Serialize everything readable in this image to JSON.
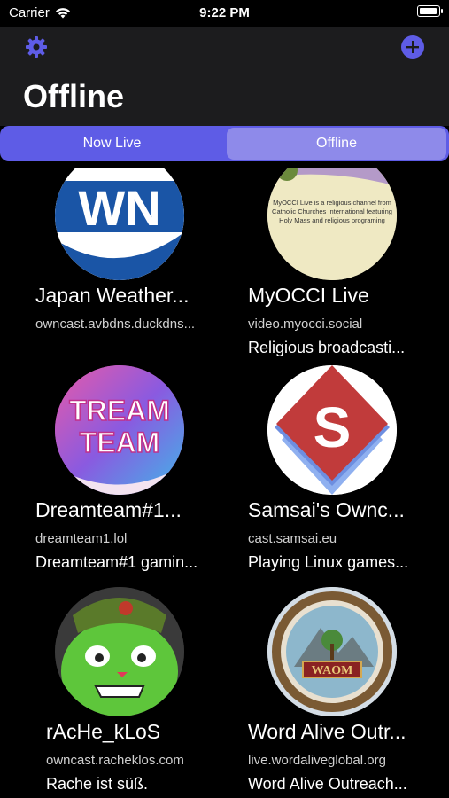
{
  "status": {
    "carrier": "Carrier",
    "time": "9:22 PM"
  },
  "header": {
    "title": "Offline"
  },
  "segments": [
    "Now Live",
    "Offline"
  ],
  "streams": [
    {
      "name": "Japan Weather...",
      "host": "owncast.avbdns.duckdns...",
      "desc": ""
    },
    {
      "name": "MyOCCI Live",
      "host": "video.myocci.social",
      "desc": "Religious broadcasti..."
    },
    {
      "name": "Dreamteam#1...",
      "host": "dreamteam1.lol",
      "desc": "Dreamteam#1 gamin..."
    },
    {
      "name": "Samsai's Ownc...",
      "host": "cast.samsai.eu",
      "desc": "Playing Linux games..."
    },
    {
      "name": "rAcHe_kLoS",
      "host": "owncast.racheklos.com",
      "desc": "Rache ist süß."
    },
    {
      "name": "Word Alive Outr...",
      "host": "live.wordaliveglobal.org",
      "desc": "Word Alive Outreach..."
    }
  ],
  "avatar_text": {
    "wn": "WN",
    "occi": "MyOCCI Live is a religious channel from Catholic Churches International featuring Holy Mass and religious programing",
    "dream_1": "TREAM",
    "dream_2": "TEAM",
    "samsai": "S",
    "waom": "WAOM"
  },
  "colors": {
    "accent": "#5e5ce6",
    "nav_bg": "#1c1c1e",
    "segment_selected": "#8e8aea"
  }
}
